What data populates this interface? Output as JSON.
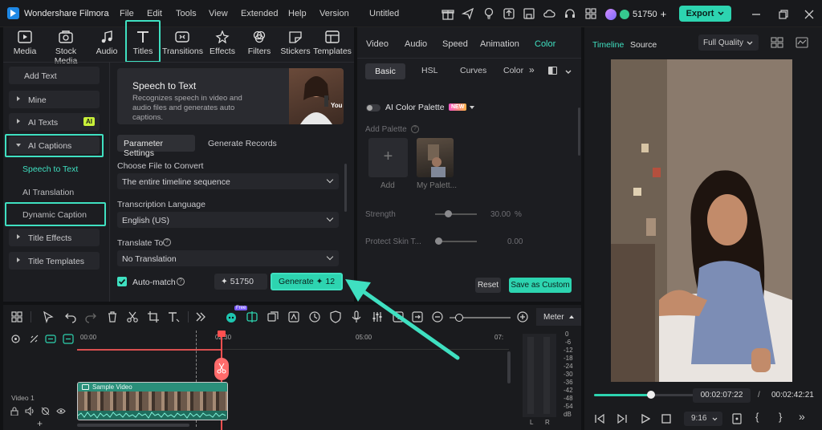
{
  "app": {
    "name": "Wondershare Filmora",
    "project_title": "Untitled",
    "menu": [
      "File",
      "Edit",
      "Tools",
      "View",
      "Extended",
      "Help",
      "Version"
    ],
    "credits": "51750",
    "export_label": "Export"
  },
  "library_tabs": [
    "Media",
    "Stock Media",
    "Audio",
    "Titles",
    "Transitions",
    "Effects",
    "Filters",
    "Stickers",
    "Templates"
  ],
  "sidebar": {
    "add_text": "Add Text",
    "mine": "Mine",
    "ai_texts": "AI Texts",
    "ai_badge": "AI",
    "ai_captions": "AI Captions",
    "speech_to_text": "Speech to Text",
    "ai_translation": "AI Translation",
    "dynamic_caption": "Dynamic Caption",
    "title_effects": "Title Effects",
    "title_templates": "Title Templates"
  },
  "speech_panel": {
    "title": "Speech to Text",
    "description": "Recognizes speech in video and audio files and generates auto captions.",
    "banner_badge": "You",
    "tab_params": "Parameter Settings",
    "tab_records": "Generate Records",
    "choose_file_label": "Choose File to Convert",
    "choose_file_value": "The entire timeline sequence",
    "language_label": "Transcription Language",
    "language_value": "English (US)",
    "translate_label": "Translate To",
    "translate_value": "No Translation",
    "automatch_label": "Auto-match",
    "credits_value": "51750",
    "generate_label": "Generate",
    "generate_cost": "12"
  },
  "properties": {
    "tabs": [
      "Video",
      "Audio",
      "Speed",
      "Animation",
      "Color"
    ],
    "subtabs": [
      "Basic",
      "HSL",
      "Curves",
      "Color"
    ],
    "ai_palette_label": "AI Color Palette",
    "new_badge": "NEW",
    "add_palette_label": "Add Palette",
    "add_label": "Add",
    "my_palette_label": "My Palett...",
    "strength_label": "Strength",
    "strength_value": "30.00",
    "strength_unit": "%",
    "strength_level_pct": 30,
    "protect_skin_label": "Protect Skin T...",
    "protect_skin_value": "0.00",
    "reset_label": "Reset",
    "save_custom_label": "Save as Custom"
  },
  "player": {
    "tab_timeline": "Timeline",
    "tab_source": "Source",
    "quality": "Full Quality",
    "current_time": "00:02:07:22",
    "separator": "/",
    "total_time": "00:02:42:21",
    "progress_pct": 78,
    "aspect": "9:16"
  },
  "timeline": {
    "meter_label": "Meter",
    "ruler": [
      "00:00",
      "02:30",
      "05:00",
      "07:"
    ],
    "track_label": "Video 1",
    "clip_label": "Sample Video",
    "db_scale": [
      "0",
      "-6",
      "-12",
      "-18",
      "-24",
      "-30",
      "-36",
      "-42",
      "-48",
      "-54",
      "dB"
    ],
    "channels": [
      "L",
      "R"
    ],
    "new_badge": "Free"
  },
  "colors": {
    "accent": "#2dd4b0",
    "highlight": "#3fe0c1",
    "playhead": "#ff5050",
    "clip": "#2a8f7a"
  }
}
